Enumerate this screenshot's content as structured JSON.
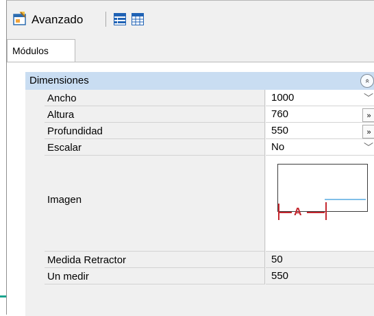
{
  "toolbar": {
    "title": "Avanzado",
    "icons": [
      "properties-window-icon",
      "categorized-view-icon",
      "table-view-icon"
    ]
  },
  "tab": {
    "label": "Módulos"
  },
  "group": {
    "title": "Dimensiones",
    "collapse_glyph": "«"
  },
  "properties": [
    {
      "label": "Ancho",
      "value": "1000",
      "editor": "dropdown"
    },
    {
      "label": "Altura",
      "value": "760",
      "editor": "ellipsis"
    },
    {
      "label": "Profundidad",
      "value": "550",
      "editor": "ellipsis"
    },
    {
      "label": "Escalar",
      "value": "No",
      "editor": "dropdown"
    },
    {
      "label": "Imagen",
      "preview_text": "A",
      "editor": "image"
    },
    {
      "label": "Medida Retractor",
      "value": "50",
      "editor": "none"
    },
    {
      "label": "Un medir",
      "value": "550",
      "editor": "none"
    }
  ],
  "glyphs": {
    "dropdown": "﹀",
    "ellipsis": "»"
  },
  "colors": {
    "group_header": "#c9ddf2",
    "accent": "#19a48e",
    "preview_red": "#c4262e"
  }
}
